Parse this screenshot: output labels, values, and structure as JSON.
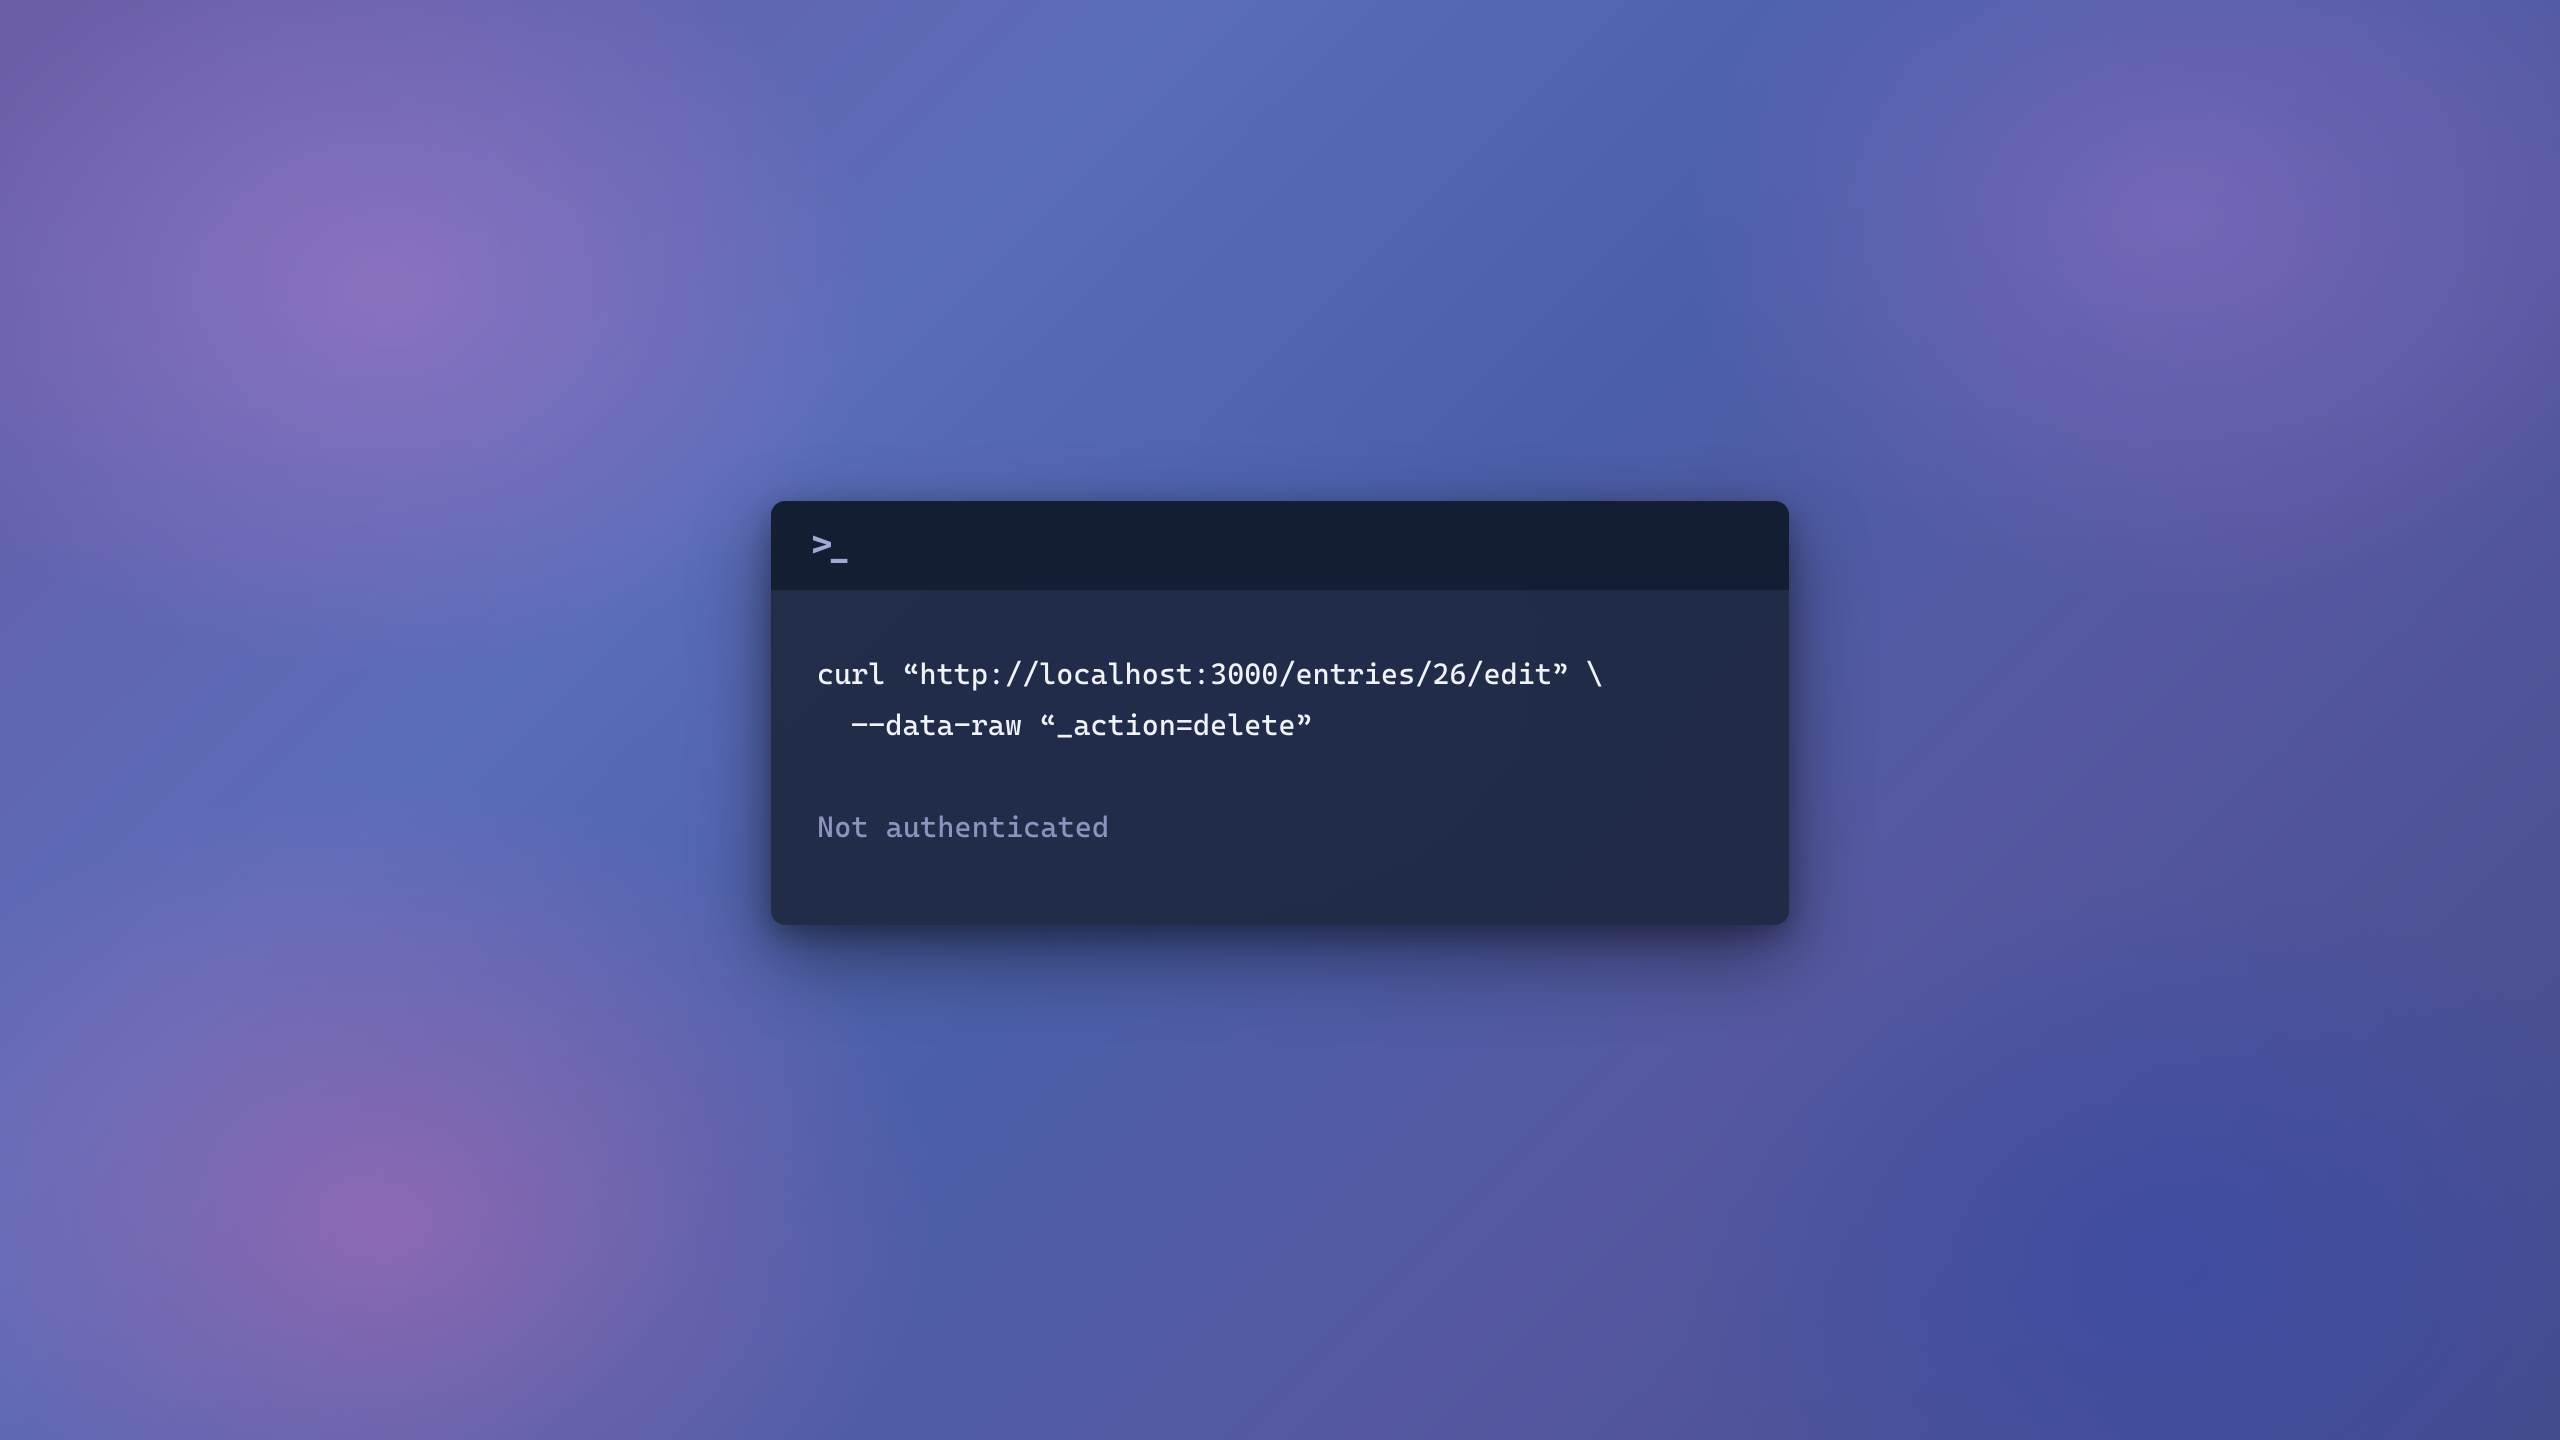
{
  "titlebar": {
    "prompt_icon": ">_"
  },
  "terminal": {
    "command_line_1": "curl “http://localhost:3000/entries/26/edit” \\",
    "command_line_2": "  –-data-raw “_action=delete”",
    "output": "Not authenticated"
  }
}
